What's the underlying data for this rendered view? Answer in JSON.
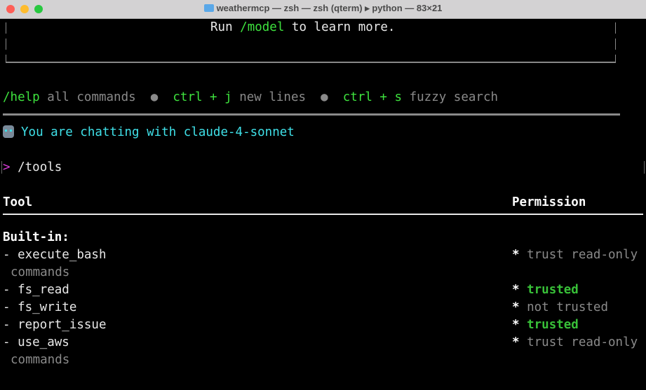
{
  "window": {
    "title": "weathermcp — zsh — zsh (qterm) ▸ python — 83×21"
  },
  "banner": {
    "run": "Run",
    "model_cmd": "/model",
    "rest": "to learn more."
  },
  "hints": {
    "help_cmd": "/help",
    "help_text": "all commands",
    "bullet": "●",
    "ctrl_j": "ctrl + j",
    "ctrl_j_text": "new lines",
    "ctrl_s": "ctrl + s",
    "ctrl_s_text": "fuzzy search"
  },
  "chat": {
    "icon": "robot-icon",
    "message": "You are chatting with claude-4-sonnet"
  },
  "prompt": {
    "symbol": ">",
    "command": "/tools"
  },
  "table": {
    "headers": {
      "tool": "Tool",
      "permission": "Permission"
    },
    "section": "Built-in:",
    "rows": [
      {
        "tool": "- execute_bash",
        "continuation": "commands",
        "star": "*",
        "permission": "trust read-only",
        "status": "readonly"
      },
      {
        "tool": "- fs_read",
        "star": "*",
        "permission": "trusted",
        "status": "trusted"
      },
      {
        "tool": "- fs_write",
        "star": "*",
        "permission": "not trusted",
        "status": "untrusted"
      },
      {
        "tool": "- report_issue",
        "star": "*",
        "permission": "trusted",
        "status": "trusted"
      },
      {
        "tool": "- use_aws",
        "continuation": "commands",
        "star": "*",
        "permission": "trust read-only",
        "status": "readonly"
      }
    ]
  },
  "colors": {
    "green": "#3ee23e",
    "cyan": "#3fe0e8",
    "magenta": "#d83cd8",
    "gray": "#8a8a8a",
    "trusted": "#38c038"
  }
}
